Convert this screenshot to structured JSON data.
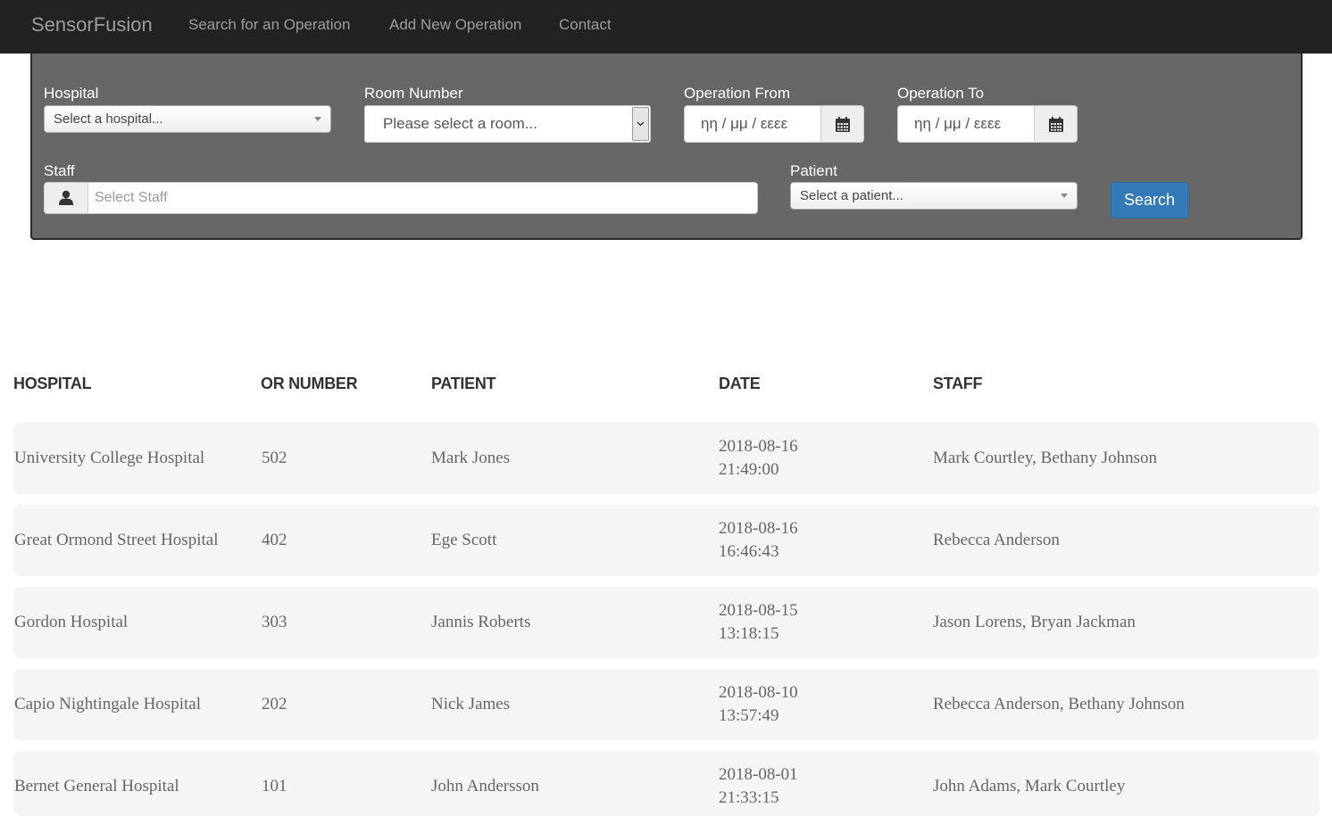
{
  "navbar": {
    "brand": "SensorFusion",
    "links": [
      "Search for an Operation",
      "Add New Operation",
      "Contact"
    ]
  },
  "filters": {
    "hospital_label": "Hospital",
    "hospital_value": "Select a hospital...",
    "room_label": "Room Number",
    "room_value": "Please select a room...",
    "from_label": "Operation From",
    "from_placeholder": "ηη / μμ / εεεε",
    "to_label": "Operation To",
    "to_placeholder": "ηη / μμ / εεεε",
    "staff_label": "Staff",
    "staff_placeholder": "Select Staff",
    "patient_label": "Patient",
    "patient_value": "Select a patient...",
    "search_label": "Search"
  },
  "table": {
    "headers": [
      "HOSPITAL",
      "OR NUMBER",
      "PATIENT",
      "DATE",
      "STAFF"
    ],
    "rows": [
      {
        "hospital": "University College Hospital",
        "or": "502",
        "patient": "Mark Jones",
        "date": "2018-08-16",
        "time": "21:49:00",
        "staff": "Mark Courtley, Bethany Johnson"
      },
      {
        "hospital": "Great Ormond Street Hospital",
        "or": "402",
        "patient": "Ege Scott",
        "date": "2018-08-16",
        "time": "16:46:43",
        "staff": "Rebecca Anderson"
      },
      {
        "hospital": "Gordon Hospital",
        "or": "303",
        "patient": "Jannis Roberts",
        "date": "2018-08-15",
        "time": "13:18:15",
        "staff": "Jason Lorens, Bryan Jackman"
      },
      {
        "hospital": "Capio Nightingale Hospital",
        "or": "202",
        "patient": "Nick James",
        "date": "2018-08-10",
        "time": "13:57:49",
        "staff": "Rebecca Anderson, Bethany Johnson"
      },
      {
        "hospital": "Bernet General Hospital",
        "or": "101",
        "patient": "John Andersson",
        "date": "2018-08-01",
        "time": "21:33:15",
        "staff": "John Adams, Mark Courtley"
      }
    ]
  },
  "colors": {
    "navbar_bg": "#222222",
    "panel_bg": "#676767",
    "primary_button": "#337ab7",
    "row_bg": "#f5f5f5"
  },
  "icons": [
    "calendar-icon",
    "user-icon",
    "chevron-down-icon"
  ]
}
